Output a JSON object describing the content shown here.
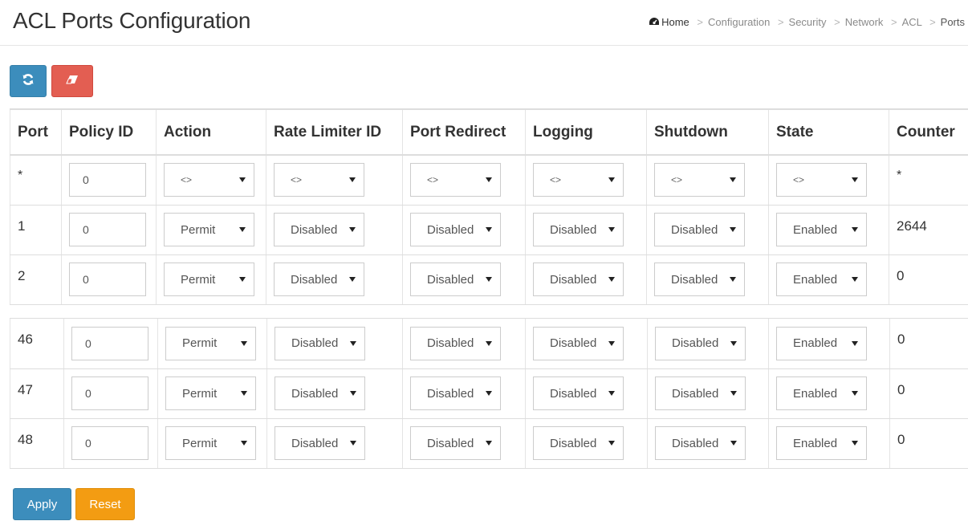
{
  "header": {
    "title": "ACL Ports Configuration",
    "breadcrumb": {
      "home": "Home",
      "items": [
        "Configuration",
        "Security",
        "Network",
        "ACL"
      ],
      "current": "Ports",
      "separator": ">"
    }
  },
  "toolbar": {
    "refresh_icon": "refresh-icon",
    "clear_icon": "eraser-icon"
  },
  "table": {
    "columns": [
      "Port",
      "Policy ID",
      "Action",
      "Rate Limiter ID",
      "Port Redirect",
      "Logging",
      "Shutdown",
      "State",
      "Counter"
    ],
    "wildcard_row": {
      "port": "*",
      "policy_id": "0",
      "action": "<>",
      "rate_limiter": "<>",
      "port_redirect": "<>",
      "logging": "<>",
      "shutdown": "<>",
      "state": "<>",
      "counter": "*"
    },
    "rows": [
      {
        "port": "1",
        "policy_id": "0",
        "action": "Permit",
        "rate_limiter": "Disabled",
        "port_redirect": "Disabled",
        "logging": "Disabled",
        "shutdown": "Disabled",
        "state": "Enabled",
        "counter": "2644"
      },
      {
        "port": "2",
        "policy_id": "0",
        "action": "Permit",
        "rate_limiter": "Disabled",
        "port_redirect": "Disabled",
        "logging": "Disabled",
        "shutdown": "Disabled",
        "state": "Enabled",
        "counter": "0"
      },
      {
        "port": "46",
        "policy_id": "0",
        "action": "Permit",
        "rate_limiter": "Disabled",
        "port_redirect": "Disabled",
        "logging": "Disabled",
        "shutdown": "Disabled",
        "state": "Enabled",
        "counter": "0"
      },
      {
        "port": "47",
        "policy_id": "0",
        "action": "Permit",
        "rate_limiter": "Disabled",
        "port_redirect": "Disabled",
        "logging": "Disabled",
        "shutdown": "Disabled",
        "state": "Enabled",
        "counter": "0"
      },
      {
        "port": "48",
        "policy_id": "0",
        "action": "Permit",
        "rate_limiter": "Disabled",
        "port_redirect": "Disabled",
        "logging": "Disabled",
        "shutdown": "Disabled",
        "state": "Enabled",
        "counter": "0"
      }
    ]
  },
  "footer": {
    "apply_label": "Apply",
    "reset_label": "Reset"
  },
  "colors": {
    "primary": "#3c8dbc",
    "danger": "#e35e52",
    "warning": "#f39c12"
  }
}
